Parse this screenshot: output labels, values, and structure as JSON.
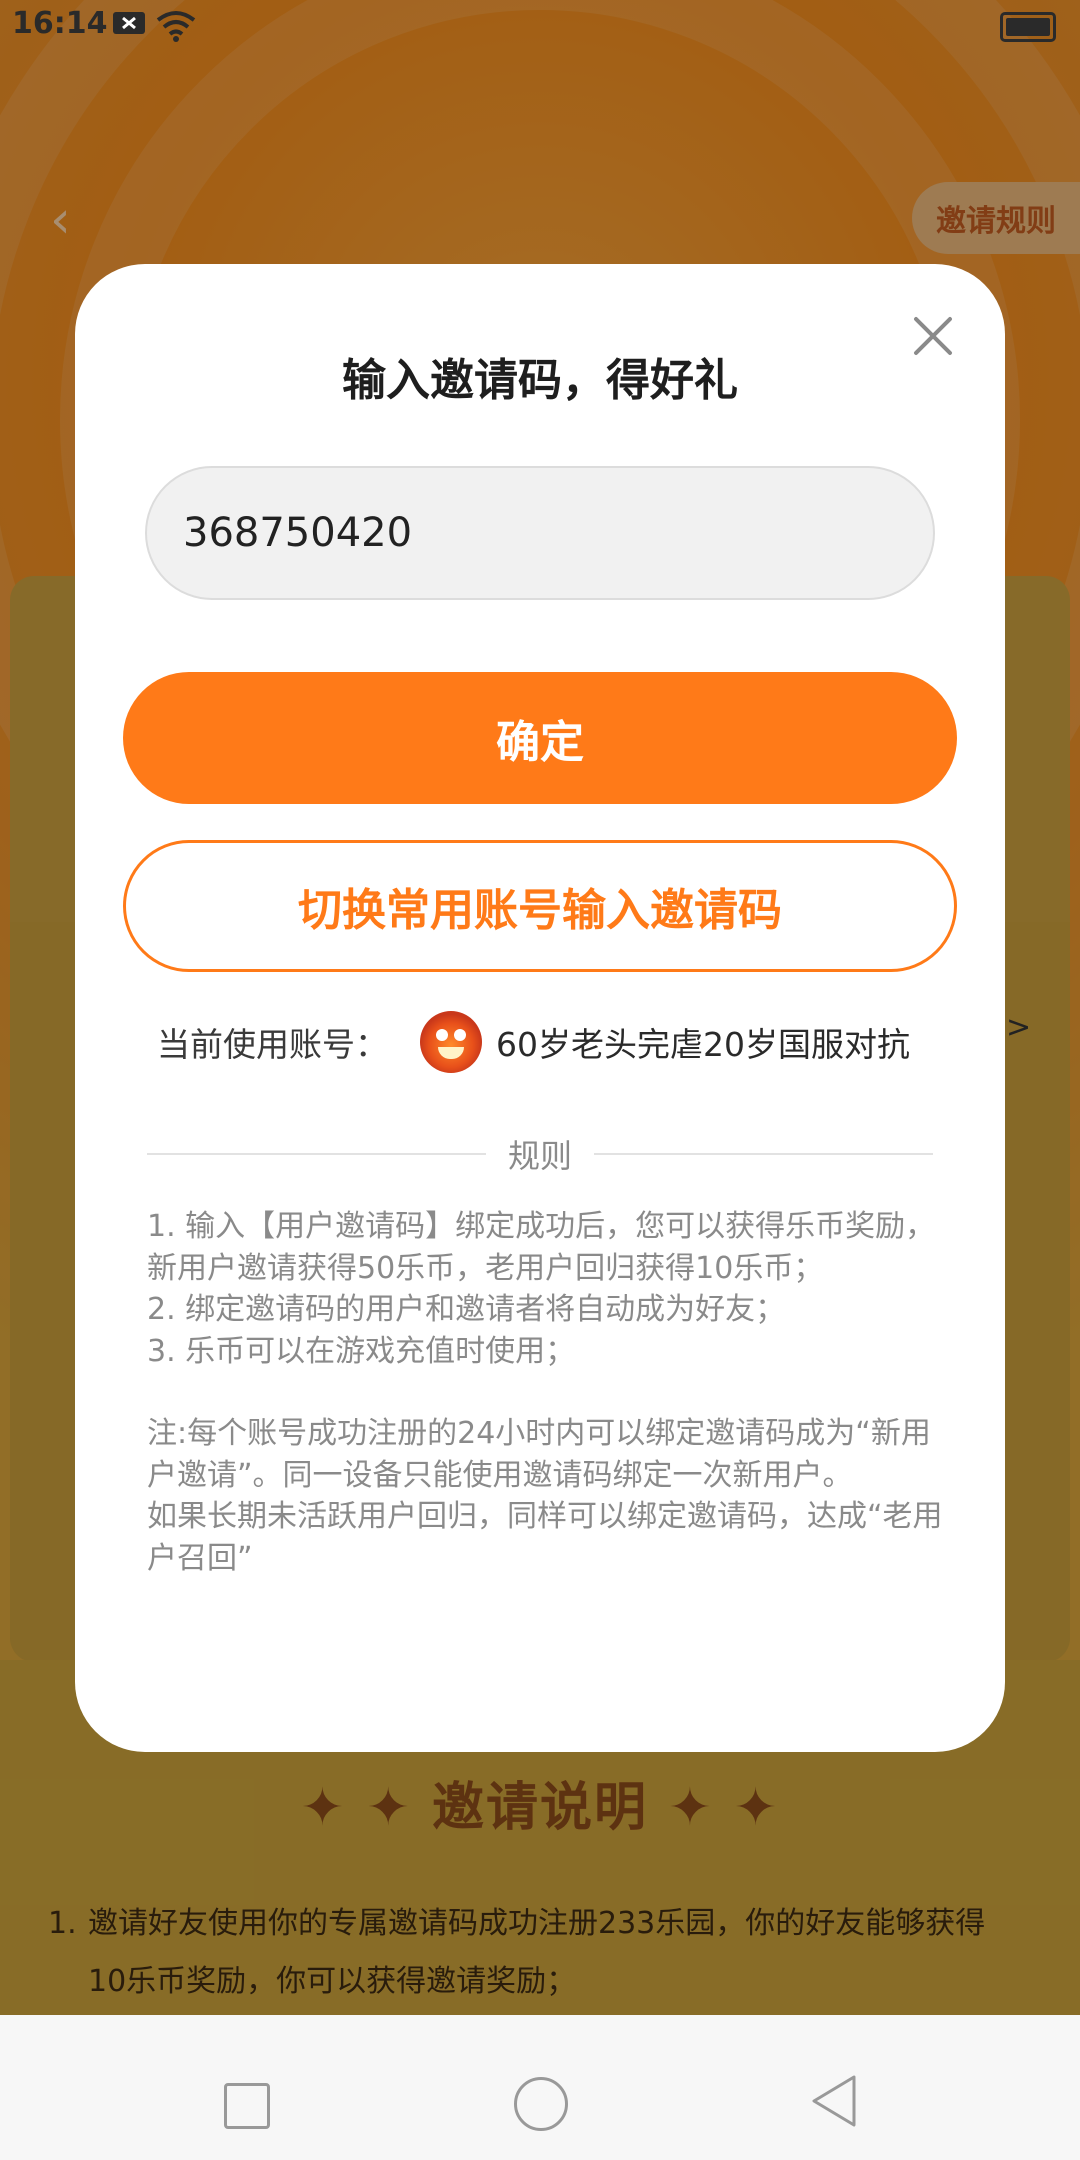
{
  "status_bar": {
    "time": "16:14"
  },
  "background": {
    "rules_pill": "邀请规则",
    "section_title": "✦ ✦  邀请说明  ✦ ✦",
    "rule_1_num": "1.",
    "rule_1_text": "邀请好友使用你的专属邀请码成功注册233乐园，你的好友能够获得10乐币奖励，你可以获得邀请奖励；"
  },
  "modal": {
    "title": "输入邀请码，得好礼",
    "invite_code_value": "368750420",
    "confirm_label": "确定",
    "switch_label": "切换常用账号输入邀请码",
    "account_label": "当前使用账号：",
    "account_name": "60岁老头完虐20岁国服对抗",
    "rules_title": "规则",
    "rules": [
      " 1. 输入【用户邀请码】绑定成功后，您可以获得乐币奖励，新用户邀请获得50乐币，老用户回归获得10乐币；",
      "2. 绑定邀请码的用户和邀请者将自动成为好友；",
      "3. 乐币可以在游戏充值时使用；"
    ],
    "notes": [
      " 注:每个账号成功注册的24小时内可以绑定邀请码成为“新用户邀请”。同一设备只能使用邀请码绑定一次新用户。",
      "如果长期未活跃用户回归，同样可以绑定邀请码，达成“老用户召回”"
    ]
  },
  "colors": {
    "accent": "#ff7a18",
    "modal_bg": "#ffffff",
    "rules_text": "#8a8a8a"
  },
  "icons": [
    "close-icon",
    "wifi-icon",
    "battery-icon",
    "back-chevron-icon",
    "avatar"
  ]
}
